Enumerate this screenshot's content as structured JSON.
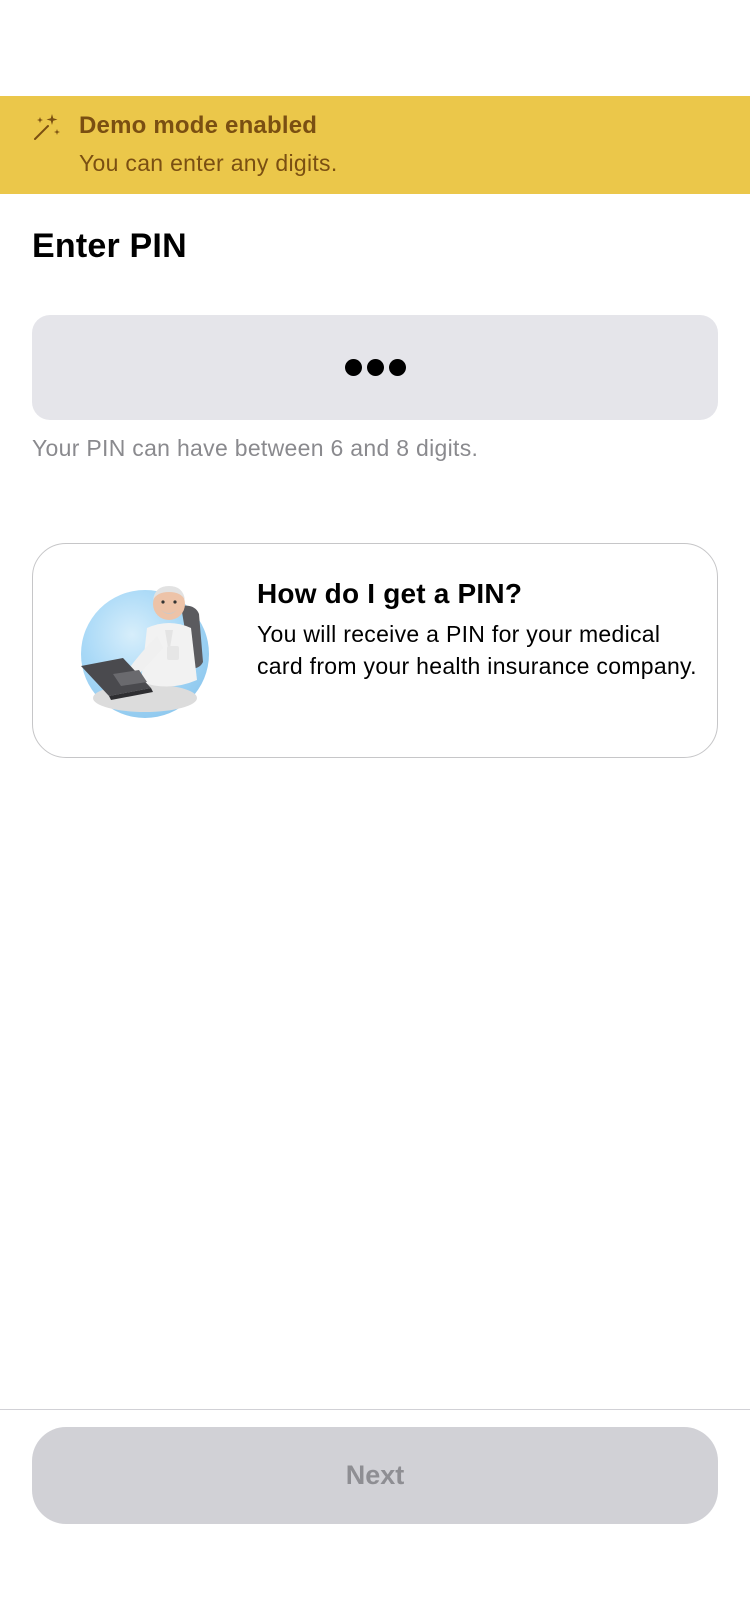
{
  "demo_banner": {
    "icon": "magic-wand-sparkles-icon",
    "title": "Demo mode enabled",
    "subtitle": "You can enter any digits."
  },
  "page": {
    "title": "Enter PIN"
  },
  "pin_input": {
    "entered_digit_count": 3,
    "hint": "Your PIN can have between 6 and 8 digits."
  },
  "info_card": {
    "illustration": "elderly-man-at-laptop-illustration",
    "title": "How do I get a PIN?",
    "body": "You will receive a PIN for your medical card from your health insurance company."
  },
  "footer": {
    "next_label": "Next",
    "next_enabled": false
  },
  "colors": {
    "banner_background": "#EBC74A",
    "banner_text": "#7A4F12",
    "field_background": "#E5E5EA",
    "disabled_button": "#D1D1D6",
    "disabled_text": "#8E8E93"
  }
}
